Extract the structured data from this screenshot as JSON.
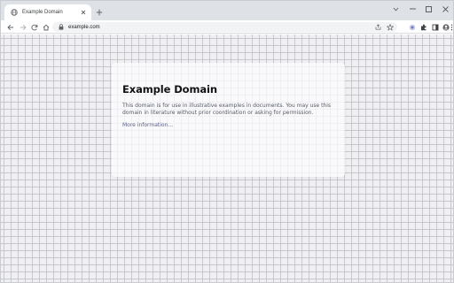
{
  "browser": {
    "tab": {
      "title": "Example Domain",
      "favicon": "globe-icon"
    },
    "new_tab_icon": "plus-icon",
    "window_controls": [
      "minimize-icon",
      "maximize-icon",
      "close-icon"
    ],
    "address_bar": {
      "url": "example.com",
      "secure_icon": "lock-icon"
    },
    "toolbar_icons": [
      "share-icon",
      "star-icon",
      "extension-icon",
      "puzzle-icon",
      "sidepanel-icon",
      "profile-icon",
      "menu-icon"
    ]
  },
  "page": {
    "heading": "Example Domain",
    "paragraph": "This domain is for use in illustrative examples in documents. You may use this domain in literature without prior coordination or asking for permission.",
    "link_text": "More information..."
  },
  "colors": {
    "tabstrip_bg": "#dee1e6",
    "page_bg": "#f0f0f2",
    "grid_line": "#c8c8cc",
    "link": "#38488f"
  }
}
